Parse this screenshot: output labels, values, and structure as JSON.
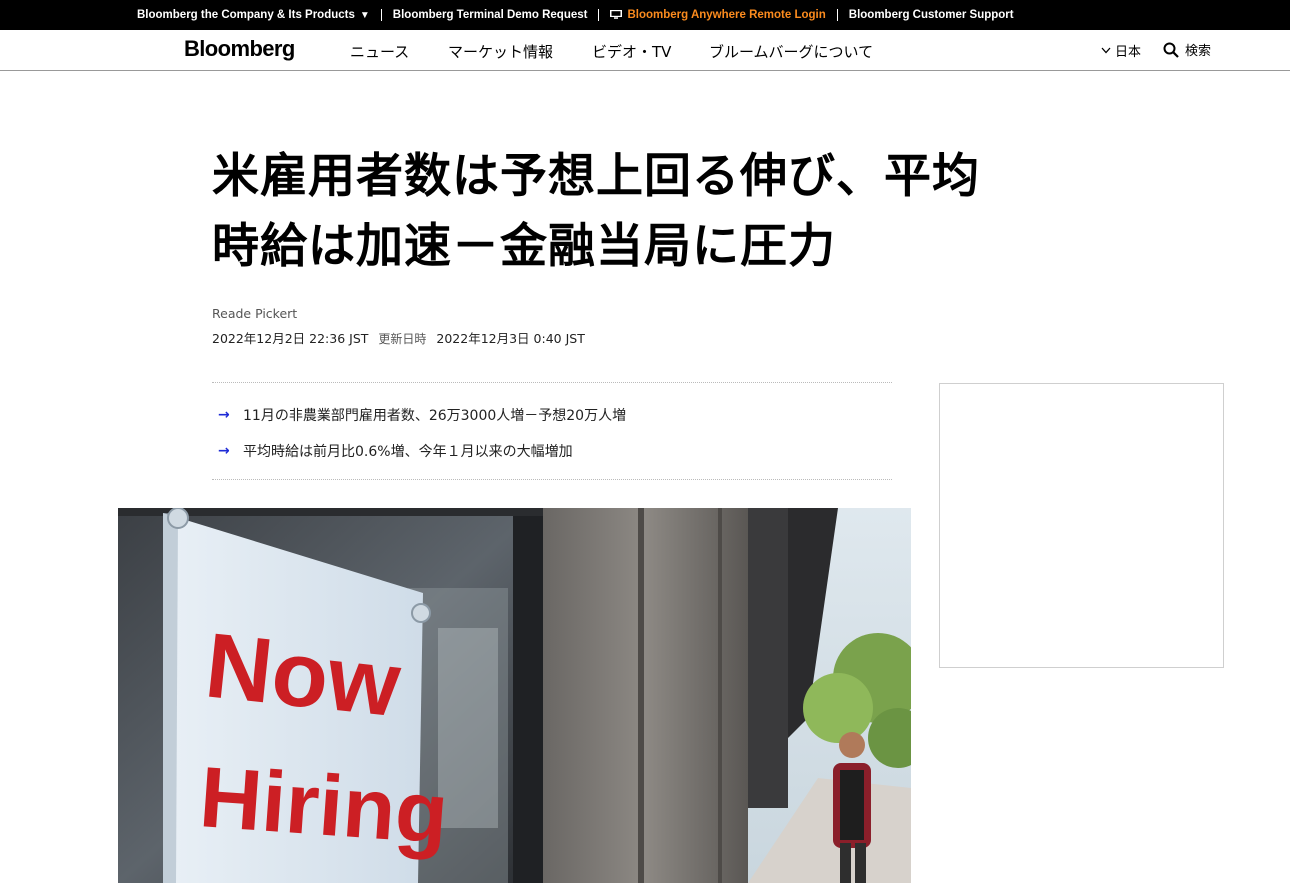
{
  "topbar": {
    "company": "Bloomberg the Company & Its Products",
    "terminal_demo": "Bloomberg Terminal Demo Request",
    "anywhere_login": "Bloomberg Anywhere Remote Login",
    "support": "Bloomberg Customer Support",
    "accent_color": "#fb8b1e"
  },
  "nav": {
    "logo": "Bloomberg",
    "links": [
      "ニュース",
      "マーケット情報",
      "ビデオ・TV",
      "ブルームバーグについて"
    ],
    "region": "日本",
    "search": "検索"
  },
  "article": {
    "headline_line1": "米雇用者数は予想上回る伸び、平均",
    "headline_line2": "時給は加速－金融当局に圧力",
    "author": "Reade Pickert",
    "published": "2022年12月2日 22:36 JST",
    "updated_label": "更新日時",
    "updated": "2022年12月3日 0:40 JST",
    "abstract": [
      "11月の非農業部門雇用者数、26万3000人増－予想20万人増",
      "平均時給は前月比0.6%増、今年１月以来の大幅増加"
    ],
    "image_sign_line1": "Now",
    "image_sign_line2": "Hiring"
  },
  "icons": {
    "dropdown": "chevron-down-icon",
    "terminal": "terminal-icon",
    "search": "search-icon",
    "bullet": "arrow-right-icon"
  }
}
